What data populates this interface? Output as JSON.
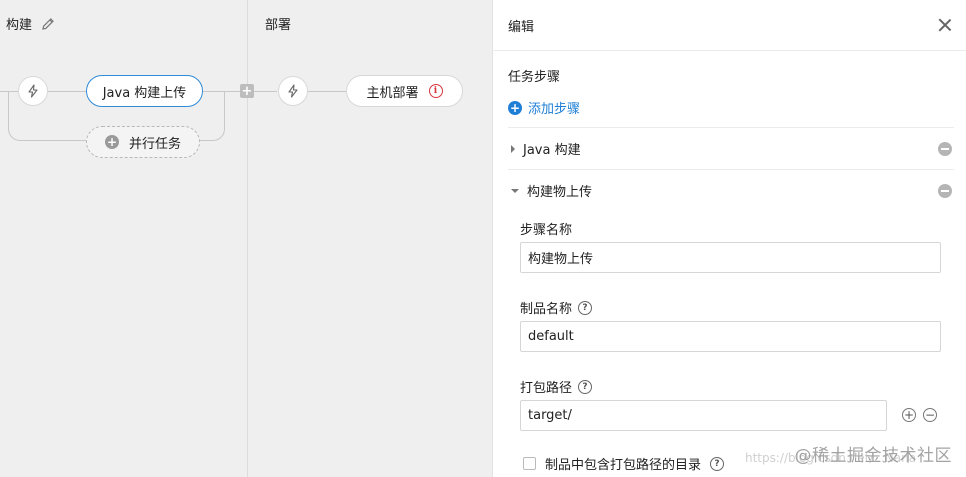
{
  "pipeline": {
    "stages": [
      {
        "title": "构建"
      },
      {
        "title": "部署"
      }
    ],
    "jobs": {
      "java_upload": "Java 构建上传",
      "parallel_task": "并行任务",
      "host_deploy": "主机部署"
    }
  },
  "panel": {
    "title": "编辑",
    "section_title": "任务步骤",
    "add_step_label": "添加步骤",
    "steps": [
      {
        "label": "Java 构建",
        "expanded": false
      },
      {
        "label": "构建物上传",
        "expanded": true
      }
    ],
    "form": {
      "step_name_label": "步骤名称",
      "step_name_value": "构建物上传",
      "artifact_name_label": "制品名称",
      "artifact_name_value": "default",
      "pack_path_label": "打包路径",
      "pack_path_value": "target/",
      "include_dir_label": "制品中包含打包路径的目录"
    }
  },
  "watermark": {
    "text": "@稀土掘金技术社区",
    "url": "https://blog.csdn.net/...Nana"
  },
  "colors": {
    "accent": "#1f7fd6",
    "error": "#d9363e",
    "canvas_bg": "#efefef"
  }
}
